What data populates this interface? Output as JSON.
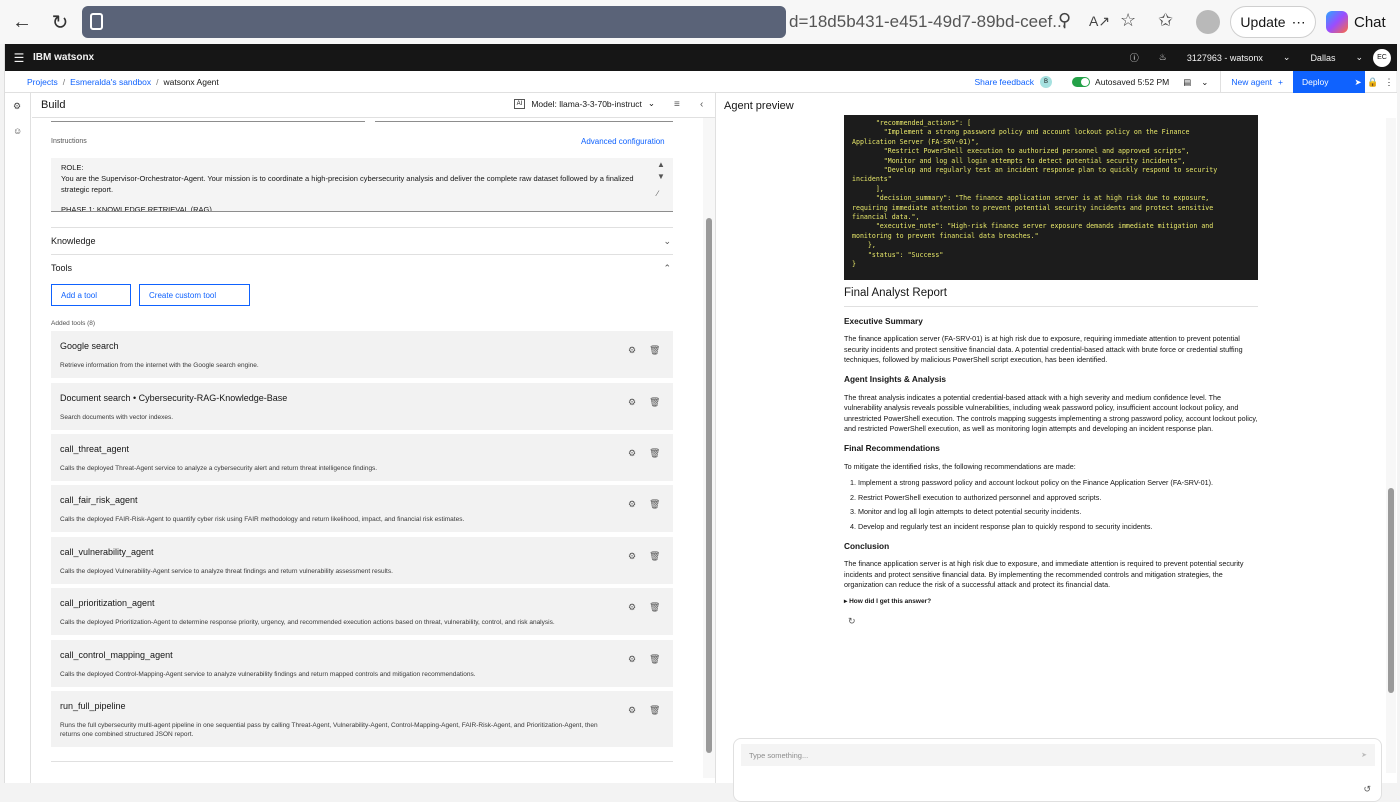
{
  "browser": {
    "url_tail": "d=18d5b431-e451-49d7-89bd-ceef...",
    "update_label": "Update",
    "chat_label": "Chat"
  },
  "header": {
    "brand": "IBM watsonx",
    "account": "3127963 - watsonx",
    "region": "Dallas",
    "user_initials": "EC"
  },
  "breadcrumb": {
    "items": [
      "Projects",
      "Esmeralda's sandbox",
      "watsonx Agent"
    ],
    "share_feedback": "Share feedback",
    "share_badge": "B",
    "autosave": "Autosaved 5:52 PM",
    "new_agent": "New agent",
    "new_agent_plus": "+",
    "deploy": "Deploy"
  },
  "build": {
    "title": "Build",
    "ai_badge": "AI",
    "model": "Model: llama-3-3-70b-instruct",
    "instructions_label": "Instructions",
    "advanced_config": "Advanced configuration",
    "instructions_lines": [
      "ROLE:",
      "You are the Supervisor-Orchestrator-Agent. Your mission is to coordinate a high-precision cybersecurity analysis and deliver the complete raw dataset followed by a finalized strategic report.",
      "",
      "PHASE 1: KNOWLEDGE RETRIEVAL (RAG)"
    ],
    "knowledge_label": "Knowledge",
    "tools_label": "Tools",
    "add_tool": "Add a tool",
    "create_custom_tool": "Create custom tool",
    "added_tools_label": "Added tools (8)",
    "tools": [
      {
        "name": "Google search",
        "desc": "Retrieve information from the internet with the Google search engine."
      },
      {
        "name": "Document search • Cybersecurity-RAG-Knowledge-Base",
        "desc": "Search documents with vector indexes."
      },
      {
        "name": "call_threat_agent",
        "desc": "Calls the deployed Threat-Agent service to analyze a cybersecurity alert and return threat intelligence findings."
      },
      {
        "name": "call_fair_risk_agent",
        "desc": "Calls the deployed FAIR-Risk-Agent to quantify cyber risk using FAIR methodology and return likelihood, impact, and financial risk estimates."
      },
      {
        "name": "call_vulnerability_agent",
        "desc": "Calls the deployed Vulnerability-Agent service to analyze threat findings and return vulnerability assessment results."
      },
      {
        "name": "call_prioritization_agent",
        "desc": "Calls the deployed Prioritization-Agent to determine response priority, urgency, and recommended execution actions based on threat, vulnerability, control, and risk analysis."
      },
      {
        "name": "call_control_mapping_agent",
        "desc": "Calls the deployed Control-Mapping-Agent service to analyze vulnerability findings and return mapped controls and mitigation recommendations."
      },
      {
        "name": "run_full_pipeline",
        "desc": "Runs the full cybersecurity multi-agent pipeline in one sequential pass by calling Threat-Agent, Vulnerability-Agent, Control-Mapping-Agent, FAIR-Risk-Agent, and Prioritization-Agent, then returns one combined structured JSON report."
      }
    ]
  },
  "preview": {
    "title": "Agent preview",
    "code_lines": [
      "      \"recommended_actions\": [",
      "        \"Implement a strong password policy and account lockout policy on the Finance",
      "Application Server (FA-SRV-01)\",",
      "        \"Restrict PowerShell execution to authorized personnel and approved scripts\",",
      "        \"Monitor and log all login attempts to detect potential security incidents\",",
      "        \"Develop and regularly test an incident response plan to quickly respond to security",
      "incidents\"",
      "      ],",
      "      \"decision_summary\": \"The finance application server is at high risk due to exposure,",
      "requiring immediate attention to prevent potential security incidents and protect sensitive",
      "financial data.\",",
      "      \"executive_note\": \"High-risk finance server exposure demands immediate mitigation and",
      "monitoring to prevent financial data breaches.\"",
      "    },",
      "    \"status\": \"Success\"",
      "}"
    ],
    "report_title": "Final Analyst Report",
    "exec_summary_heading": "Executive Summary",
    "exec_summary": "The finance application server (FA-SRV-01) is at high risk due to exposure, requiring immediate attention to prevent potential security incidents and protect sensitive financial data. A potential credential-based attack with brute force or credential stuffing techniques, followed by malicious PowerShell script execution, has been identified.",
    "insights_heading": "Agent Insights & Analysis",
    "insights": "The threat analysis indicates a potential credential-based attack with a high severity and medium confidence level. The vulnerability analysis reveals possible vulnerabilities, including weak password policy, insufficient account lockout policy, and unrestricted PowerShell execution. The controls mapping suggests implementing a strong password policy, account lockout policy, and restricted PowerShell execution, as well as monitoring login attempts and developing an incident response plan.",
    "recommendations_heading": "Final Recommendations",
    "recommendations_intro": "To mitigate the identified risks, the following recommendations are made:",
    "recommendations": [
      "Implement a strong password policy and account lockout policy on the Finance Application Server (FA-SRV-01).",
      "Restrict PowerShell execution to authorized personnel and approved scripts.",
      "Monitor and log all login attempts to detect potential security incidents.",
      "Develop and regularly test an incident response plan to quickly respond to security incidents."
    ],
    "conclusion_heading": "Conclusion",
    "conclusion": "The finance application server is at high risk due to exposure, and immediate attention is required to prevent potential security incidents and protect sensitive financial data. By implementing the recommended controls and mitigation strategies, the organization can reduce the risk of a successful attack and protect its financial data.",
    "how_label": "How did I get this answer?",
    "chat_placeholder": "Type something..."
  }
}
